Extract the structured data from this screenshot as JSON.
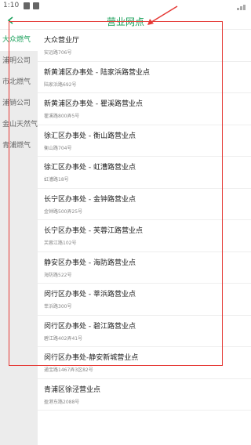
{
  "status": {
    "time": "1:10"
  },
  "header": {
    "back_icon": "arrow-left-icon",
    "title": "营业网点"
  },
  "sidebar": {
    "items": [
      {
        "label": "大众燃气",
        "active": true
      },
      {
        "label": "浦明公司",
        "active": false
      },
      {
        "label": "市北燃气",
        "active": false
      },
      {
        "label": "浦销公司",
        "active": false
      },
      {
        "label": "金山天然气",
        "active": false
      },
      {
        "label": "青浦燃气",
        "active": false
      }
    ]
  },
  "list": {
    "items": [
      {
        "name": "大众营业厅",
        "address": "安远路706号"
      },
      {
        "name": "新黄浦区办事处 - 陆家浜路营业点",
        "address": "陆家浜路692号"
      },
      {
        "name": "新黄浦区办事处 - 瞿溪路营业点",
        "address": "瞿溪路800弄5号"
      },
      {
        "name": "徐汇区办事处 - 衡山路营业点",
        "address": "衡山路704号"
      },
      {
        "name": "徐汇区办事处 - 虹漕路营业点",
        "address": "虹漕路18号"
      },
      {
        "name": "长宁区办事处 - 金钟路营业点",
        "address": "金钟路500弄25号"
      },
      {
        "name": "长宁区办事处 - 芙蓉江路营业点",
        "address": "芙蓉江路102号"
      },
      {
        "name": "静安区办事处 - 海防路营业点",
        "address": "海防路522号"
      },
      {
        "name": "闵行区办事处 - 莘浜路营业点",
        "address": "莘浜路300号"
      },
      {
        "name": "闵行区办事处 - 碧江路营业点",
        "address": "碧江路402弄41号"
      },
      {
        "name": "闵行区办事处-静安新城营业点",
        "address": "通宝路1467弄3区82号"
      },
      {
        "name": "青浦区徐泾营业点",
        "address": "盈港东路2088号"
      }
    ]
  },
  "colors": {
    "accent": "#19a05a",
    "annotation": "#e53935",
    "sidebar_bg": "#ececec"
  }
}
